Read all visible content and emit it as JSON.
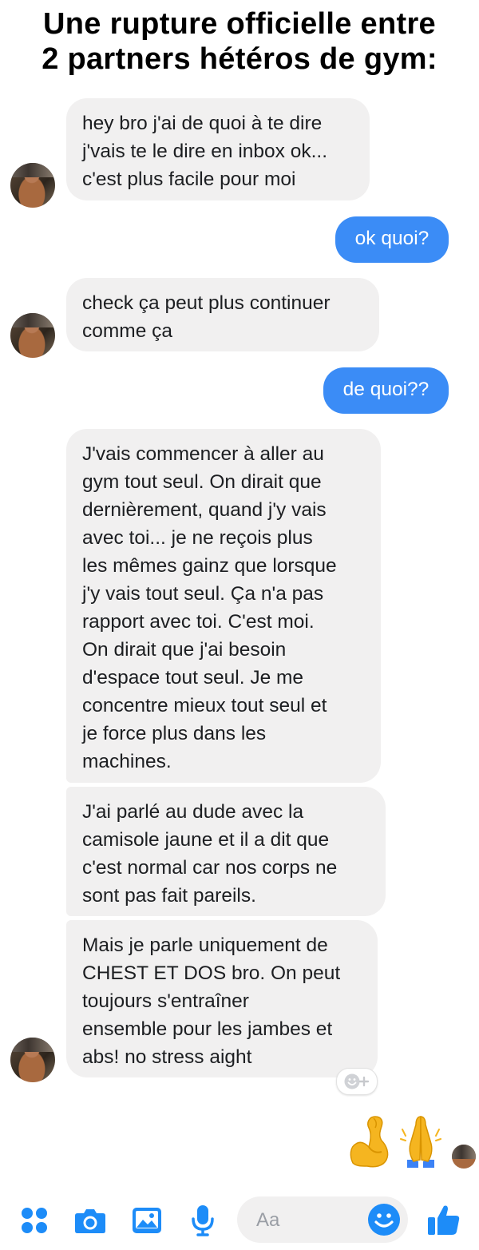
{
  "caption": {
    "line1": "Une rupture officielle entre",
    "line2": "2 partners hétéros de gym:"
  },
  "messages": [
    {
      "from": "friend",
      "text": "hey bro j'ai de quoi à te dire\nj'vais te le dire en inbox ok...\nc'est plus facile pour moi"
    },
    {
      "from": "me",
      "text": "ok quoi?"
    },
    {
      "from": "friend",
      "text": "check ça peut plus continuer\ncomme ça"
    },
    {
      "from": "me",
      "text": "de quoi??"
    },
    {
      "from": "friend",
      "text": "J'vais commencer à aller au\ngym tout seul. On dirait que\ndernièrement, quand j'y vais\navec toi... je ne reçois plus\nles mêmes gainz que lorsque\nj'y vais tout seul. Ça n'a pas\nrapport avec toi. C'est moi.\nOn dirait que j'ai besoin\nd'espace tout seul. Je me\nconcentre mieux tout seul et\nje force plus dans les\nmachines."
    },
    {
      "from": "friend",
      "text": "J'ai parlé au dude avec la\ncamisole jaune et il a dit que\nc'est normal car nos corps ne\nsont pas fait pareils."
    },
    {
      "from": "friend",
      "text": "Mais je parle uniquement de\nCHEST ET DOS bro. On peut\ntoujours s'entraîner\nensemble pour les jambes et\nabs! no stress aight"
    }
  ],
  "reply_emojis": [
    "flexed-biceps",
    "folded-hands"
  ],
  "composer": {
    "placeholder": "Aa"
  },
  "colors": {
    "outgoing_bubble": "#3b8cf6",
    "incoming_bubble": "#f1f0f0",
    "icon_blue": "#1d8cf8"
  }
}
